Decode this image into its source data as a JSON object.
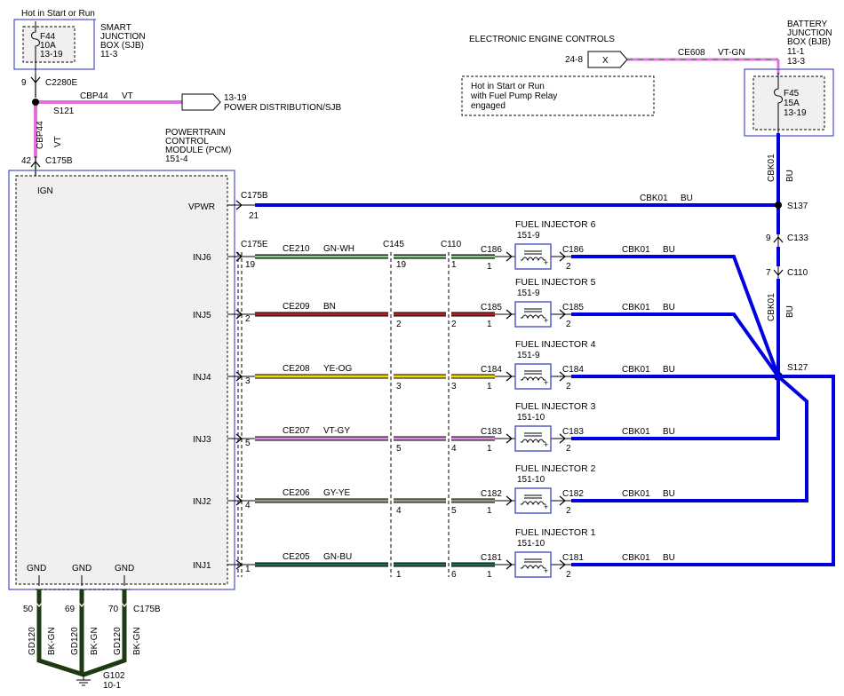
{
  "sjb": {
    "hot_label": "Hot in Start or Run",
    "fuse": "F44",
    "amps": "10A",
    "page": "13-19",
    "title1": "SMART",
    "title2": "JUNCTION",
    "title3": "BOX (SJB)",
    "ref": "11-3",
    "pin": "9",
    "connector": "C2280E"
  },
  "cbp44": {
    "circuit": "CBP44",
    "color": "VT",
    "splice": "S121",
    "dest_page": "13-19",
    "dest_label": "POWER DISTRIBUTION/SJB",
    "vertical_circuit": "CBP44",
    "vertical_color": "VT"
  },
  "pcm": {
    "title1": "POWERTRAIN",
    "title2": "CONTROL",
    "title3": "MODULE (PCM)",
    "ref": "151-4",
    "ign_pin": "42",
    "ign_connector": "C175B",
    "ign_label": "IGN",
    "vpwr_label": "VPWR",
    "vpwr_connector": "C175B",
    "vpwr_pin": "21",
    "gnd_labels": [
      "GND",
      "GND",
      "GND"
    ],
    "gnd_pins": [
      "50",
      "69",
      "70"
    ],
    "gnd_connector": "C175B"
  },
  "eec": {
    "title": "ELECTRONIC ENGINE CONTROLS",
    "page": "24-8",
    "symbol": "X",
    "circuit": "CE608",
    "color": "VT-GN"
  },
  "note": {
    "line1": "Hot in Start or Run",
    "line2": "with Fuel Pump Relay",
    "line3": "engaged"
  },
  "bjb": {
    "title1": "BATTERY",
    "title2": "JUNCTION",
    "title3": "BOX (BJB)",
    "ref1": "11-1",
    "ref2": "13-3",
    "fuse": "F45",
    "amps": "15A",
    "page": "13-19",
    "circuit": "CBK01",
    "color": "BU"
  },
  "vpwr_wire": {
    "circuit": "CBK01",
    "color": "BU",
    "splice1": "S137",
    "c133_pin": "9",
    "c133": "C133",
    "c110_pin": "7",
    "c110": "C110",
    "lower_circuit": "CBK01",
    "lower_color": "BU",
    "splice2": "S127"
  },
  "inline_connectors": {
    "pcm": "C175E",
    "c145": "C145",
    "c110": "C110"
  },
  "injectors": [
    {
      "label": "INJ6",
      "circuit": "CE210",
      "color": "GN-WH",
      "pcm_pin": "19",
      "c145_pin": "19",
      "c110_pin": "1",
      "conn": "C186",
      "conn_pin": "1",
      "name": "FUEL INJECTOR 6",
      "ref": "151-9",
      "out_conn": "C186",
      "out_pin": "2",
      "out_circuit": "CBK01",
      "out_color": "BU"
    },
    {
      "label": "INJ5",
      "circuit": "CE209",
      "color": "BN",
      "pcm_pin": "2",
      "c145_pin": "2",
      "c110_pin": "2",
      "conn": "C185",
      "conn_pin": "1",
      "name": "FUEL INJECTOR 5",
      "ref": "151-9",
      "out_conn": "C185",
      "out_pin": "2",
      "out_circuit": "CBK01",
      "out_color": "BU"
    },
    {
      "label": "INJ4",
      "circuit": "CE208",
      "color": "YE-OG",
      "pcm_pin": "3",
      "c145_pin": "3",
      "c110_pin": "3",
      "conn": "C184",
      "conn_pin": "1",
      "name": "FUEL INJECTOR 4",
      "ref": "151-9",
      "out_conn": "C184",
      "out_pin": "2",
      "out_circuit": "CBK01",
      "out_color": "BU"
    },
    {
      "label": "INJ3",
      "circuit": "CE207",
      "color": "VT-GY",
      "pcm_pin": "5",
      "c145_pin": "5",
      "c110_pin": "4",
      "conn": "C183",
      "conn_pin": "1",
      "name": "FUEL INJECTOR 3",
      "ref": "151-10",
      "out_conn": "C183",
      "out_pin": "2",
      "out_circuit": "CBK01",
      "out_color": "BU"
    },
    {
      "label": "INJ2",
      "circuit": "CE206",
      "color": "GY-YE",
      "pcm_pin": "4",
      "c145_pin": "4",
      "c110_pin": "5",
      "conn": "C182",
      "conn_pin": "1",
      "name": "FUEL INJECTOR 2",
      "ref": "151-10",
      "out_conn": "C182",
      "out_pin": "2",
      "out_circuit": "CBK01",
      "out_color": "BU"
    },
    {
      "label": "INJ1",
      "circuit": "CE205",
      "color": "GN-BU",
      "pcm_pin": "1",
      "c145_pin": "1",
      "c110_pin": "6",
      "conn": "C181",
      "conn_pin": "1",
      "name": "FUEL INJECTOR 1",
      "ref": "151-10",
      "out_conn": "C181",
      "out_pin": "2",
      "out_circuit": "CBK01",
      "out_color": "BU"
    }
  ],
  "ground": {
    "wires": [
      {
        "circuit": "GD120",
        "color": "BK-GN"
      },
      {
        "circuit": "GD120",
        "color": "BK-GN"
      },
      {
        "circuit": "GD120",
        "color": "BK-GN"
      }
    ],
    "point": "G102",
    "ref": "10-1"
  },
  "colors": {
    "frame": "#4a4fc8",
    "module_fill": "#f0f0f0",
    "violet": "#e070e0",
    "blue": "#0000e0",
    "gn_wh": "#2e8b2e",
    "bn": "#b22222",
    "ye_og": "#f0d800",
    "vt_gy": "#d890d8",
    "gy_ye": "#9a9a80",
    "gn_bu": "#1f6e4a",
    "bk_gn": "#1e3a12"
  }
}
